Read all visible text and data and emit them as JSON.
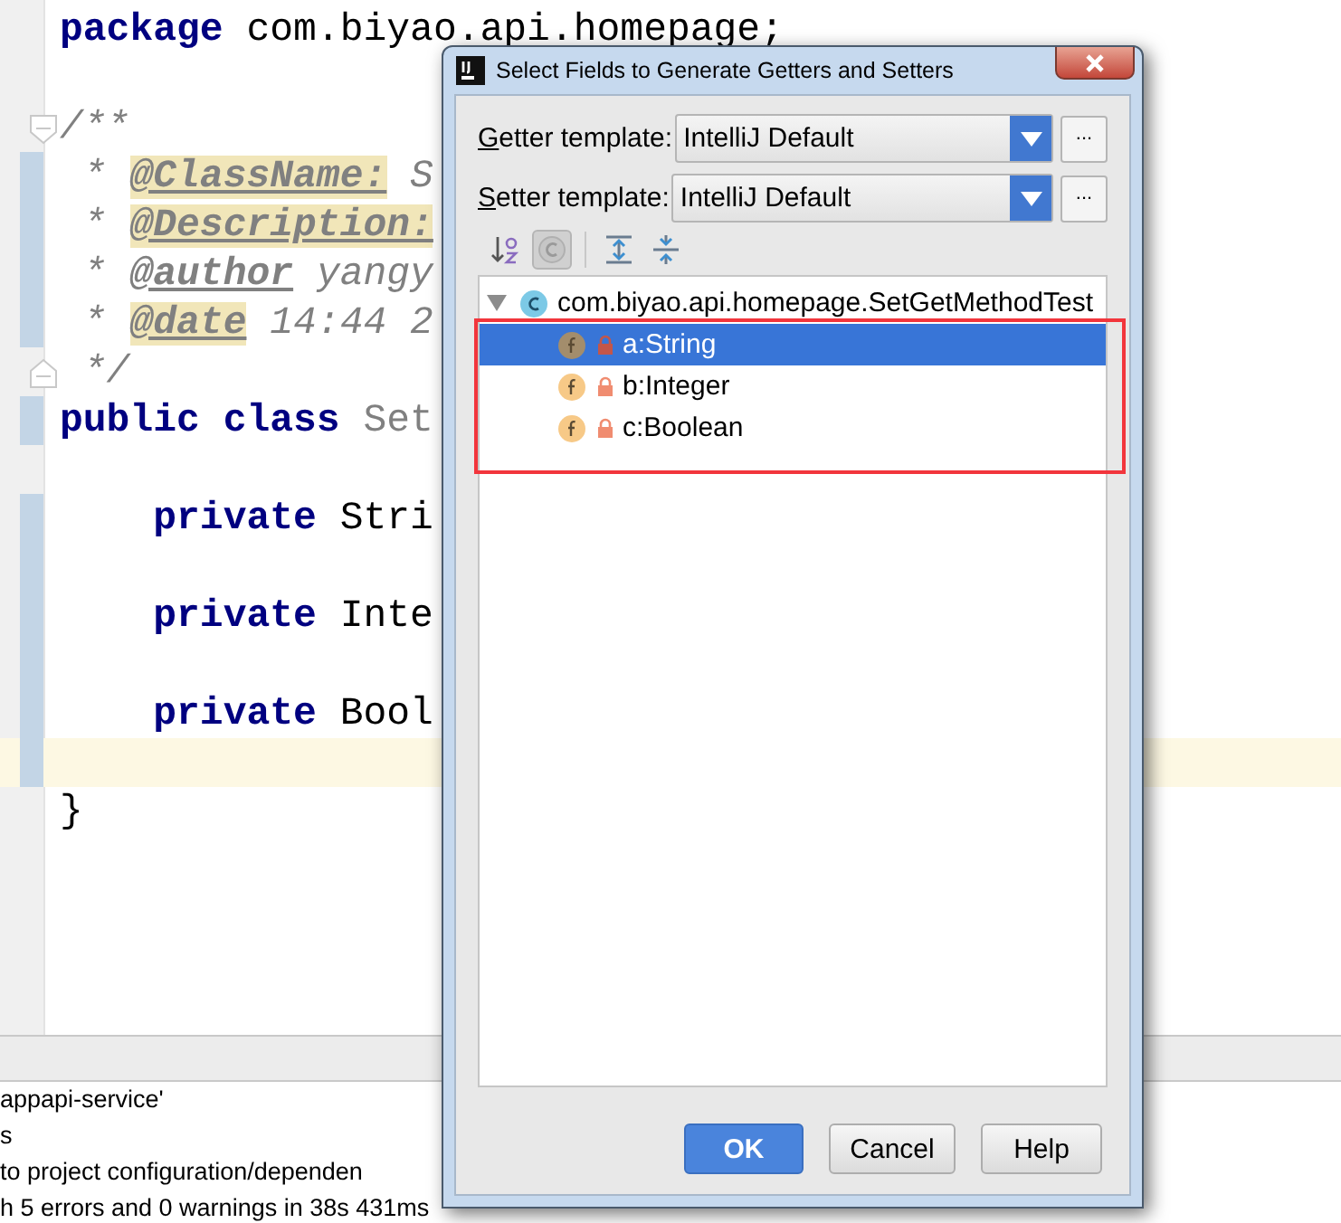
{
  "editor": {
    "lines": [
      {
        "kind": "code",
        "tokens": [
          {
            "text": "package",
            "kind": "keyword"
          },
          {
            "text": " com.biyao.api.homepage;",
            "kind": "plain"
          }
        ],
        "changed": false,
        "current": false
      },
      {
        "kind": "code",
        "changed": false,
        "current": false
      },
      {
        "kind": "fold-start",
        "tokens": [
          {
            "text": "/**",
            "kind": "comment"
          }
        ],
        "changed": false,
        "current": false
      },
      {
        "kind": "code",
        "tokens": [
          {
            "text": " * ",
            "kind": "comment"
          },
          {
            "text": "@ClassName:",
            "kind": "tag-marked"
          },
          {
            "text": " S",
            "kind": "comment"
          }
        ],
        "changed": true,
        "current": false
      },
      {
        "kind": "code",
        "tokens": [
          {
            "text": " * ",
            "kind": "comment"
          },
          {
            "text": "@Description:",
            "kind": "tag-marked"
          }
        ],
        "changed": true,
        "current": false
      },
      {
        "kind": "code",
        "tokens": [
          {
            "text": " * ",
            "kind": "comment"
          },
          {
            "text": "@author",
            "kind": "tag"
          },
          {
            "text": " yangy",
            "kind": "comment"
          }
        ],
        "changed": true,
        "current": false
      },
      {
        "kind": "code",
        "tokens": [
          {
            "text": " * ",
            "kind": "comment"
          },
          {
            "text": "@date",
            "kind": "tag-marked"
          },
          {
            "text": " 14:44 2",
            "kind": "comment"
          }
        ],
        "changed": true,
        "current": false
      },
      {
        "kind": "fold-end",
        "tokens": [
          {
            "text": " */",
            "kind": "comment"
          }
        ],
        "changed": false,
        "current": false
      },
      {
        "kind": "code",
        "tokens": [
          {
            "text": "public class",
            "kind": "keyword"
          },
          {
            "text": " Set",
            "kind": "unused"
          }
        ],
        "changed": true,
        "current": false
      },
      {
        "kind": "code",
        "changed": false,
        "current": false
      },
      {
        "kind": "code",
        "tokens": [
          {
            "text": "    private",
            "kind": "keyword"
          },
          {
            "text": " Stri",
            "kind": "plain"
          }
        ],
        "changed": true,
        "current": false
      },
      {
        "kind": "code",
        "changed": true,
        "current": false
      },
      {
        "kind": "code",
        "tokens": [
          {
            "text": "    private",
            "kind": "keyword"
          },
          {
            "text": " Inte",
            "kind": "plain"
          }
        ],
        "changed": true,
        "current": false
      },
      {
        "kind": "code",
        "changed": true,
        "current": false
      },
      {
        "kind": "code",
        "tokens": [
          {
            "text": "    private",
            "kind": "keyword"
          },
          {
            "text": " Bool",
            "kind": "plain"
          }
        ],
        "changed": true,
        "current": false
      },
      {
        "kind": "code",
        "changed": true,
        "current": true
      },
      {
        "kind": "code",
        "tokens": [
          {
            "text": "}",
            "kind": "plain"
          }
        ],
        "changed": false,
        "current": false
      }
    ]
  },
  "messages": [
    "appapi-service'",
    "s",
    "to project configuration/dependen",
    "h 5 errors and 0 warnings in 38s 431ms"
  ],
  "dialog": {
    "title": "Select Fields to Generate Getters and Setters",
    "getter_template": {
      "label": "Getter template:",
      "value": "IntelliJ Default",
      "more": "..."
    },
    "setter_template": {
      "label": "Setter template:",
      "value": "IntelliJ Default",
      "more": "..."
    },
    "toolbar": [
      {
        "kind": "sort",
        "pressed": false
      },
      {
        "kind": "class",
        "pressed": true
      },
      {
        "kind": "expand",
        "pressed": false
      },
      {
        "kind": "collapse",
        "pressed": false
      }
    ],
    "tree": {
      "label": "com.biyao.api.homepage.SetGetMethodTest",
      "expanded": true,
      "children": [
        {
          "label": "a:String",
          "selected": true
        },
        {
          "label": "b:Integer",
          "selected": false
        },
        {
          "label": "c:Boolean",
          "selected": false
        }
      ]
    },
    "buttons": [
      {
        "label": "OK",
        "default": true
      },
      {
        "label": "Cancel",
        "default": false
      },
      {
        "label": "Help",
        "default": false
      }
    ]
  }
}
